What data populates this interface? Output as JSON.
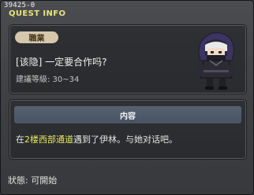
{
  "window": {
    "quest_id": "39425-0",
    "title": "QUEST INFO"
  },
  "quest": {
    "category_badge": "職業",
    "name": "[该隐] 一定要合作吗?",
    "recommended_level": "建議等級: 30~34",
    "npc": "npc-portrait"
  },
  "content": {
    "header": "内容",
    "text_pre": "在",
    "location": "2楼西部通道",
    "text_post": "遇到了伊林。与她对话吧。"
  },
  "status": {
    "text": "狀態: 可開始"
  },
  "colors": {
    "title": "#e9e47a",
    "highlight": "#e6e95c",
    "badge": "#d6c7ad",
    "content_header": "#566270"
  }
}
